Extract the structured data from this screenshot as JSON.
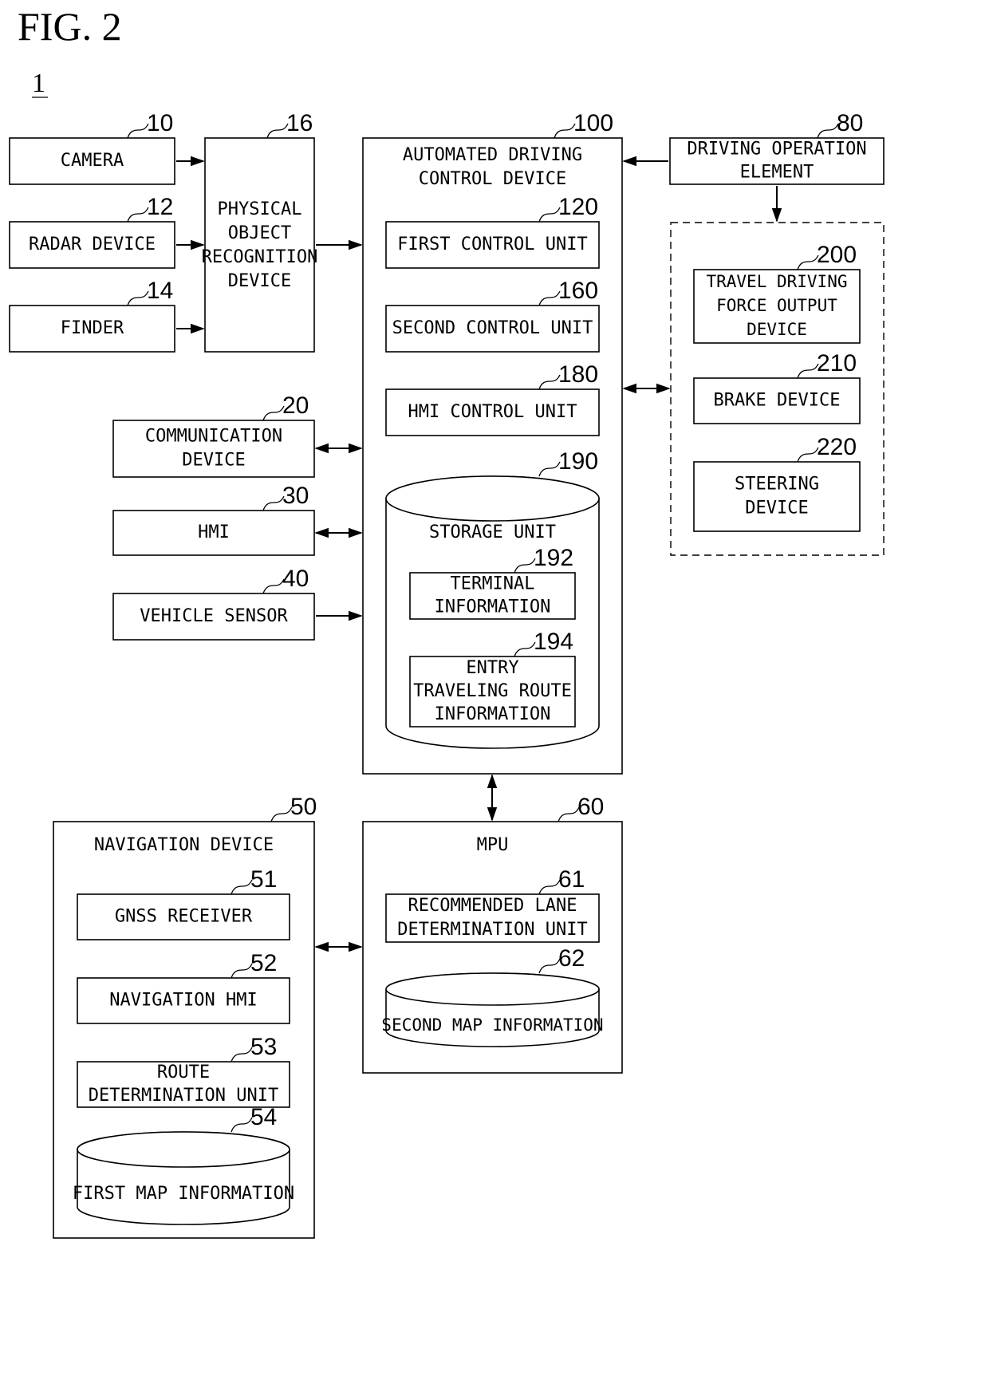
{
  "figure": {
    "title": "FIG. 2",
    "system_number": "1"
  },
  "components": {
    "camera": {
      "ref": "10",
      "lines": [
        "CAMERA"
      ]
    },
    "radar": {
      "ref": "12",
      "lines": [
        "RADAR DEVICE"
      ]
    },
    "finder": {
      "ref": "14",
      "lines": [
        "FINDER"
      ]
    },
    "object_recognition": {
      "ref": "16",
      "lines": [
        "PHYSICAL",
        "OBJECT",
        "RECOGNITION",
        "DEVICE"
      ]
    },
    "communication": {
      "ref": "20",
      "lines": [
        "COMMUNICATION",
        "DEVICE"
      ]
    },
    "hmi": {
      "ref": "30",
      "lines": [
        "HMI"
      ]
    },
    "vehicle_sensor": {
      "ref": "40",
      "lines": [
        "VEHICLE SENSOR"
      ]
    },
    "navigation": {
      "ref": "50",
      "lines": [
        "NAVIGATION DEVICE"
      ]
    },
    "gnss": {
      "ref": "51",
      "lines": [
        "GNSS RECEIVER"
      ]
    },
    "nav_hmi": {
      "ref": "52",
      "lines": [
        "NAVIGATION HMI"
      ]
    },
    "route_unit": {
      "ref": "53",
      "lines": [
        "ROUTE",
        "DETERMINATION UNIT"
      ]
    },
    "first_map": {
      "ref": "54",
      "lines": [
        "FIRST MAP INFORMATION"
      ]
    },
    "mpu": {
      "ref": "60",
      "lines": [
        "MPU"
      ]
    },
    "lane_unit": {
      "ref": "61",
      "lines": [
        "RECOMMENDED LANE",
        "DETERMINATION UNIT"
      ]
    },
    "second_map": {
      "ref": "62",
      "lines": [
        "SECOND MAP INFORMATION"
      ]
    },
    "driving_operation": {
      "ref": "80",
      "lines": [
        "DRIVING OPERATION",
        "ELEMENT"
      ]
    },
    "adcd": {
      "ref": "100",
      "lines": [
        "AUTOMATED DRIVING",
        "CONTROL DEVICE"
      ]
    },
    "first_control": {
      "ref": "120",
      "lines": [
        "FIRST CONTROL UNIT"
      ]
    },
    "second_control": {
      "ref": "160",
      "lines": [
        "SECOND CONTROL UNIT"
      ]
    },
    "hmi_control": {
      "ref": "180",
      "lines": [
        "HMI CONTROL UNIT"
      ]
    },
    "storage": {
      "ref": "190",
      "lines": [
        "STORAGE UNIT"
      ]
    },
    "terminal_info": {
      "ref": "192",
      "lines": [
        "TERMINAL",
        "INFORMATION"
      ]
    },
    "entry_route_info": {
      "ref": "194",
      "lines": [
        "ENTRY",
        "TRAVELING ROUTE",
        "INFORMATION"
      ]
    },
    "travel_force": {
      "ref": "200",
      "lines": [
        "TRAVEL DRIVING",
        "FORCE OUTPUT",
        "DEVICE"
      ]
    },
    "brake": {
      "ref": "210",
      "lines": [
        "BRAKE DEVICE"
      ]
    },
    "steering": {
      "ref": "220",
      "lines": [
        "STEERING",
        "DEVICE"
      ]
    }
  }
}
